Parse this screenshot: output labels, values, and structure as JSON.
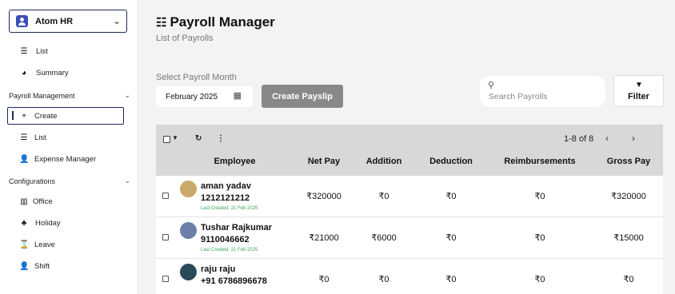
{
  "sidebar": {
    "org_name": "Atom HR",
    "top_items": [
      {
        "label": "List",
        "icon": "list-icon"
      },
      {
        "label": "Summary",
        "icon": "pie-chart-icon"
      }
    ],
    "payroll_section": "Payroll Management",
    "payroll_items": [
      {
        "label": "Create",
        "icon": "plus-icon"
      },
      {
        "label": "List",
        "icon": "list-icon"
      },
      {
        "label": "Expense Manager",
        "icon": "user-icon"
      }
    ],
    "config_section": "Configurations",
    "config_items": [
      {
        "label": "Office",
        "icon": "building-icon"
      },
      {
        "label": "Holiday",
        "icon": "holiday-icon"
      },
      {
        "label": "Leave",
        "icon": "leave-icon"
      },
      {
        "label": "Shift",
        "icon": "user-icon"
      }
    ]
  },
  "header": {
    "title": "Payroll Manager",
    "subtitle": "List of Payrolls"
  },
  "controls": {
    "select_label": "Select Payroll Month",
    "month_value": "February 2025",
    "create_button": "Create Payslip",
    "search_placeholder": "Search Payrolls",
    "filter_label": "Filter"
  },
  "table": {
    "pagination": "1-8 of 8",
    "columns": [
      "Employee",
      "Net Pay",
      "Addition",
      "Deduction",
      "Reimbursements",
      "Gross Pay"
    ],
    "rows": [
      {
        "name": "aman yadav",
        "phone": "1212121212",
        "last_created": "Last Created: 21 Feb 2025",
        "net_pay": "₹320000",
        "addition": "₹0",
        "deduction": "₹0",
        "reimbursements": "₹0",
        "gross_pay": "₹320000",
        "avatar_color": "#c9a86a"
      },
      {
        "name": "Tushar Rajkumar",
        "phone": "9110046662",
        "last_created": "Last Created: 21 Feb 2025",
        "net_pay": "₹21000",
        "addition": "₹6000",
        "deduction": "₹0",
        "reimbursements": "₹0",
        "gross_pay": "₹15000",
        "avatar_color": "#6b7fa8"
      },
      {
        "name": "raju raju",
        "phone": "+91 6786896678",
        "last_created": "",
        "net_pay": "₹0",
        "addition": "₹0",
        "deduction": "₹0",
        "reimbursements": "₹0",
        "gross_pay": "₹0",
        "avatar_color": "#2a4a5a"
      }
    ]
  },
  "colors": {
    "accent": "#1e2a5a",
    "button_gray": "#888888",
    "last_created_green": "#3aa65a"
  }
}
